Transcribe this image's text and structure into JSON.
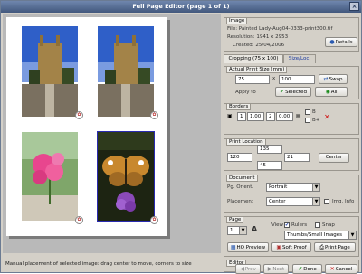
{
  "window": {
    "title": "Full Page Editor (page 1 of 1)"
  },
  "image_info": {
    "section": "Image",
    "file": "File: Painted Lady-Aug04-0333-print300.tif",
    "resolution": "Resolution: 1941 x 2953",
    "created": "Created: 25/04/2006",
    "details_label": "Details"
  },
  "tabs": [
    "Cropping (75 x 100)",
    "Size/Loc."
  ],
  "actual_size": {
    "section": "Actual Print Size (mm)",
    "width": "75",
    "height": "100",
    "swap_label": "Swap",
    "apply_to": "Apply to",
    "selected_label": "Selected",
    "all_label": "All"
  },
  "borders": {
    "section": "Borders",
    "value1": "1",
    "value2": "1.00",
    "value3": "2",
    "value4": "0.00",
    "opt_b": "B",
    "opt_bplus": "B+"
  },
  "print_location": {
    "section": "Print Location",
    "top": "135",
    "left": "120",
    "right": "21",
    "bottom": "45",
    "center_label": "Center"
  },
  "document": {
    "section": "Document",
    "orient_label": "Pg. Orient.",
    "orient_value": "Portrait",
    "placement_label": "Placement",
    "placement_value": "Center",
    "img_info_label": "Img. Info"
  },
  "page": {
    "section": "Page",
    "page_number": "1",
    "view_label": "View",
    "rulers_label": "Rulers",
    "snap_label": "Snap",
    "view_value": "Thumbs/Small Images",
    "hq_preview_label": "HQ Preview",
    "soft_proof_label": "Soft Proof",
    "print_page_label": "Print Page"
  },
  "editor": {
    "section": "Editor",
    "prev_label": "Prev",
    "next_label": "Next",
    "done_label": "Done",
    "cancel_label": "Cancel"
  },
  "status": "Manual placement of selected image: drag center to move, corners to size",
  "colors": {
    "accent": "#42587d",
    "selection": "#2a2ab0",
    "panel": "#d4d0c8"
  }
}
